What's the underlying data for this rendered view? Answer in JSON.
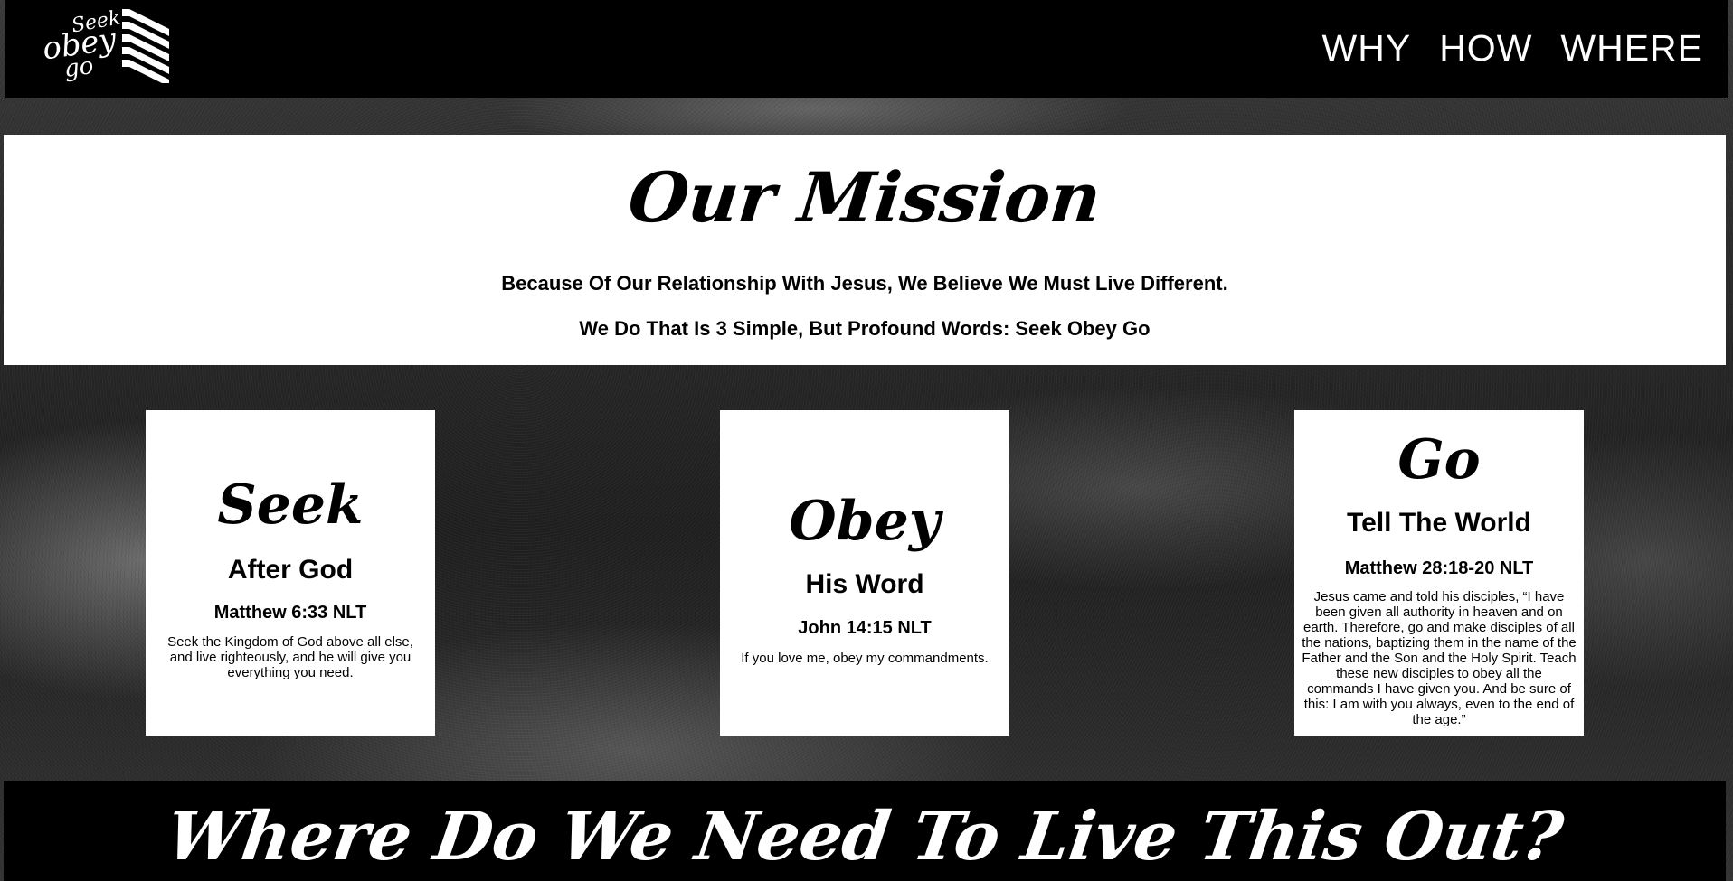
{
  "header": {
    "logo_words": [
      "Seek",
      "obey",
      "go"
    ],
    "nav": [
      {
        "label": "WHY"
      },
      {
        "label": "HOW"
      },
      {
        "label": "WHERE"
      }
    ]
  },
  "mission": {
    "title": "Our Mission",
    "line1": "Because Of Our Relationship With Jesus, We Believe We Must Live Different.",
    "line2": "We Do That Is 3 Simple, But Profound Words: Seek Obey Go"
  },
  "cards": [
    {
      "script": "Seek",
      "subtitle": "After God",
      "reference": "Matthew 6:33 NLT",
      "text": "Seek the Kingdom of God above all else, and live righteously, and he will give you everything you need."
    },
    {
      "script": "Obey",
      "subtitle": "His Word",
      "reference": "John 14:15 NLT",
      "text": "If you love me, obey my commandments."
    },
    {
      "script": "Go",
      "subtitle": "Tell The World",
      "reference": "Matthew 28:18-20 NLT",
      "text": "Jesus came and told his disciples, “I have been given all authority in heaven and on earth. Therefore, go and make disciples of all the nations, baptizing them in the name of the Father and the Son and the Holy Spirit. Teach these new disciples to obey all the commands I have given you. And be sure of this: I am with you always, even to the end of the age.”"
    }
  ],
  "banner": {
    "title": "Where Do We Need To Live This Out?"
  },
  "colors": {
    "background": "#000000",
    "panel": "#ffffff",
    "text_dark": "#000000",
    "text_light": "#ffffff"
  }
}
